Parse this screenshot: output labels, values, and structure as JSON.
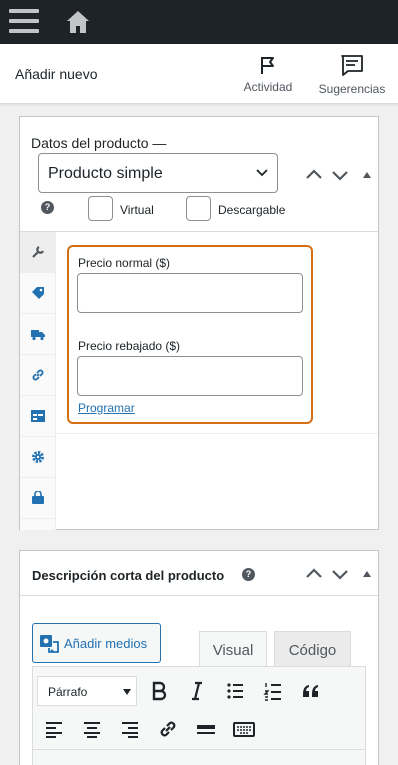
{
  "header": {
    "title": "Añadir nuevo",
    "activity_label": "Actividad",
    "suggestions_label": "Sugerencias"
  },
  "product_data": {
    "title": "Datos del producto —",
    "product_type": "Producto simple",
    "virtual_label": "Virtual",
    "downloadable_label": "Descargable",
    "regular_price_label": "Precio normal ($)",
    "regular_price_value": "",
    "sale_price_label": "Precio rebajado ($)",
    "sale_price_value": "",
    "schedule_label": "Programar",
    "tabs": [
      "general",
      "inventory",
      "shipping",
      "linked-products",
      "attributes",
      "advanced",
      "get-more-options"
    ]
  },
  "short_description": {
    "title": "Descripción corta del producto",
    "add_media_label": "Añadir medios",
    "tab_visual": "Visual",
    "tab_code": "Código",
    "format_select": "Párrafo"
  },
  "colors": {
    "admin_bar": "#1d2327",
    "accent": "#2271b1",
    "highlight_border": "#d46f15"
  }
}
